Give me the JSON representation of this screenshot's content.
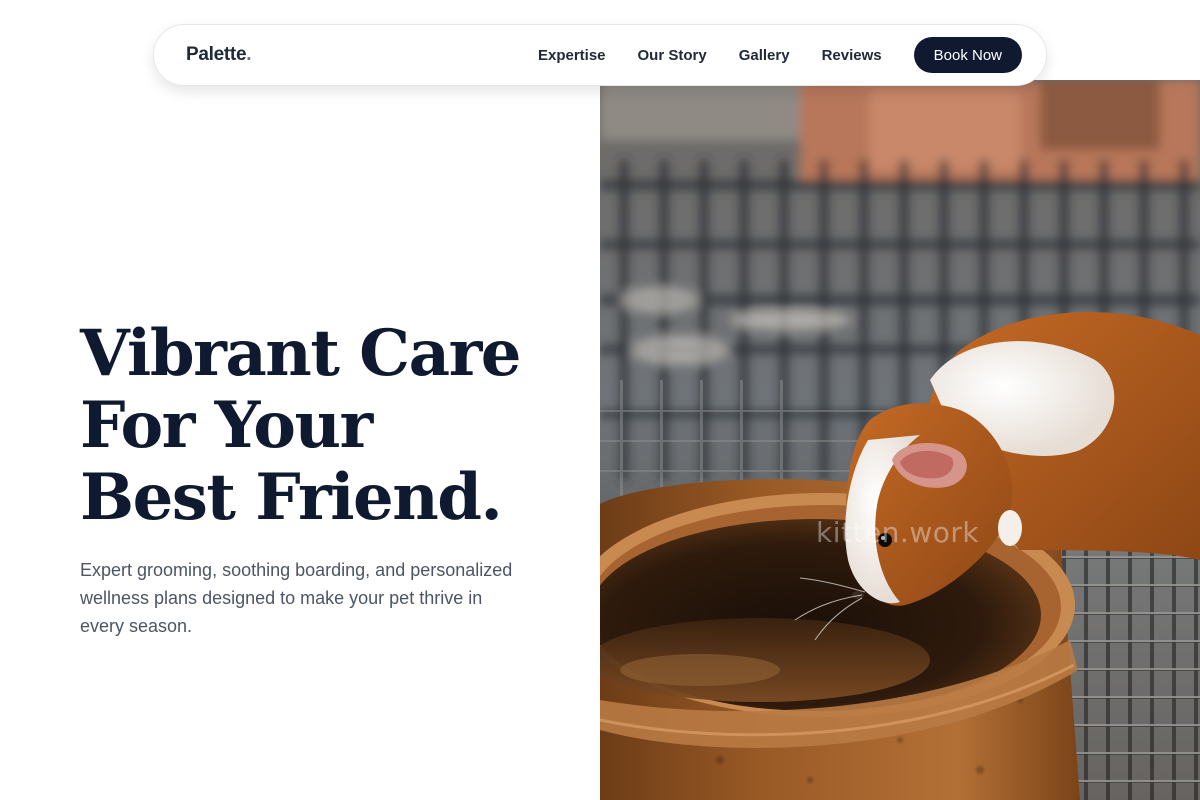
{
  "brand": {
    "name": "Palette",
    "dot": "."
  },
  "nav": {
    "links": [
      {
        "label": "Expertise"
      },
      {
        "label": "Our Story"
      },
      {
        "label": "Gallery"
      },
      {
        "label": "Reviews"
      }
    ],
    "cta_label": "Book Now"
  },
  "hero": {
    "title_lines": [
      "Vibrant Care",
      "For Your",
      "Best Friend."
    ],
    "subtitle": "Expert grooming, soothing boarding, and personalized wellness plans designed to make your pet thrive in every season.",
    "image": {
      "subject": "guinea pig drinking from a ceramic bowl",
      "watermark": "kitten.work"
    }
  },
  "colors": {
    "primary_navy": "#0f1a30",
    "body_text": "#4b5563",
    "page_background": "#ffffff"
  }
}
